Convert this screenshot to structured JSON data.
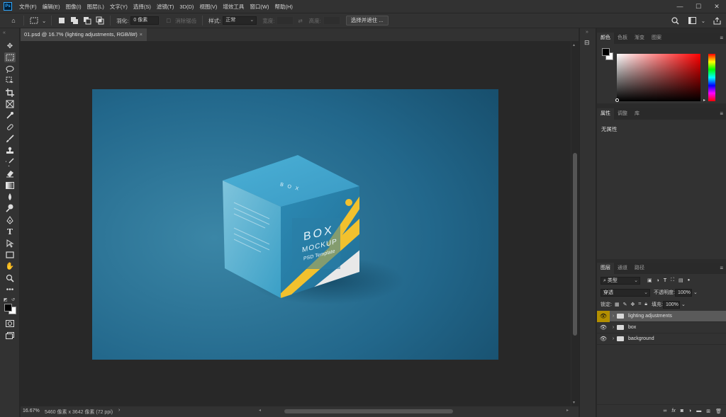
{
  "menubar": {
    "app_icon": "Ps",
    "items": [
      "文件(F)",
      "编辑(E)",
      "图像(I)",
      "图层(L)",
      "文字(Y)",
      "选择(S)",
      "滤镜(T)",
      "3D(D)",
      "视图(V)",
      "增效工具",
      "窗口(W)",
      "帮助(H)"
    ],
    "window_controls": [
      "minimize-icon",
      "maximize-icon",
      "close-icon"
    ]
  },
  "options": {
    "feather_label": "羽化:",
    "feather_value": "0 像素",
    "antialias_label": "消除锯齿",
    "style_label": "样式:",
    "style_value": "正常",
    "width_label": "宽度:",
    "height_label": "高度:",
    "select_mask_button": "选择并遮住 ..."
  },
  "tools": [
    "move-icon",
    "marquee-icon",
    "lasso-icon",
    "object-select-icon",
    "crop-icon",
    "frame-icon",
    "eyedropper-icon",
    "healing-icon",
    "brush-icon",
    "stamp-icon",
    "history-brush-icon",
    "eraser-icon",
    "gradient-icon",
    "blur-icon",
    "dodge-icon",
    "pen-icon",
    "type-icon",
    "path-select-icon",
    "rectangle-icon",
    "hand-icon",
    "zoom-icon",
    "more-icon"
  ],
  "document": {
    "tab_title": "01.psd @ 16.7% (lighting adjustments, RGB/8#)",
    "zoom": "16.67%",
    "doc_info": "5460 像素 x 3642 像素 (72 ppi)"
  },
  "mockup": {
    "box_title": "BOX",
    "box_subtitle": "MOCKUP",
    "box_template": "PSD Template",
    "box_top_text": "B O X",
    "bg_color": "#1e5a7c",
    "box_color": "#2f8fb8",
    "accent_yellow": "#f2c12e"
  },
  "color_panel": {
    "tabs": [
      "颜色",
      "色板",
      "渐变",
      "图案"
    ],
    "foreground": "#000000",
    "background": "#ffffff",
    "hue": "#ff0000"
  },
  "properties_panel": {
    "tabs": [
      "属性",
      "调整",
      "库"
    ],
    "empty_text": "无属性"
  },
  "layers_panel": {
    "tabs": [
      "图层",
      "通道",
      "路径"
    ],
    "filter_label": "类型",
    "blend_mode": "穿透",
    "opacity_label": "不透明度:",
    "opacity_value": "100%",
    "lock_label": "锁定:",
    "fill_label": "填充:",
    "fill_value": "100%",
    "layers": [
      {
        "name": "lighting adjustments",
        "selected": true
      },
      {
        "name": "box",
        "selected": false
      },
      {
        "name": "background",
        "selected": false
      }
    ],
    "footer_fx": "fx"
  }
}
